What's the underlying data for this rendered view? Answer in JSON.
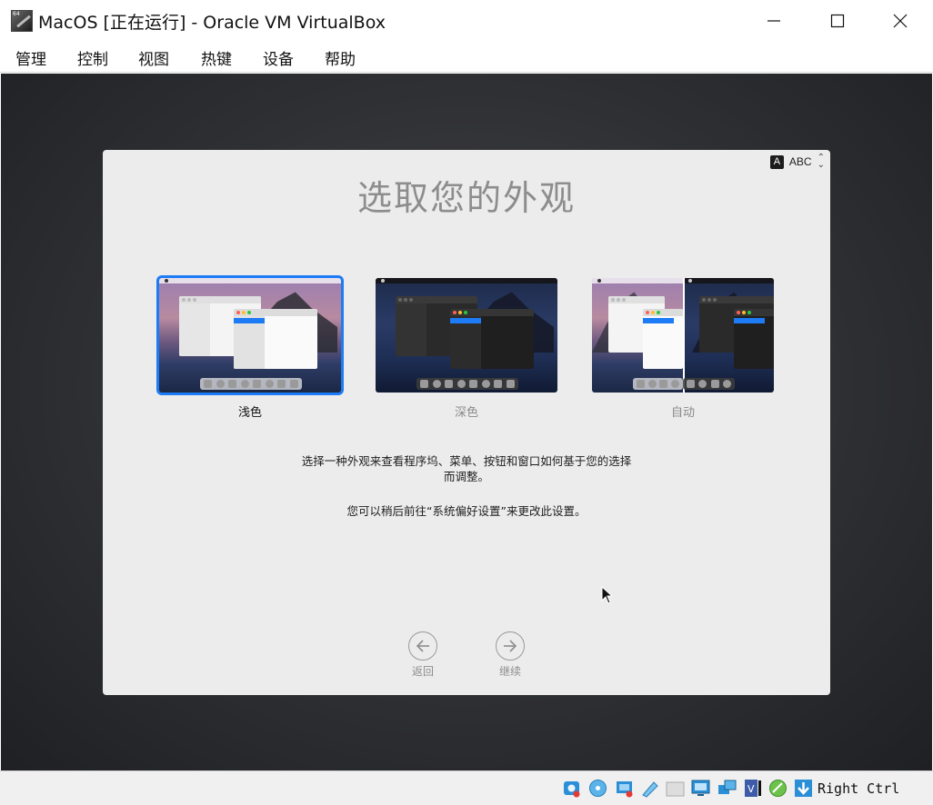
{
  "window": {
    "title": "MacOS [正在运行] - Oracle VM VirtualBox",
    "app_icon_badge": "64"
  },
  "menubar": {
    "items": [
      {
        "label": "管理"
      },
      {
        "label": "控制"
      },
      {
        "label": "视图"
      },
      {
        "label": "热键"
      },
      {
        "label": "设备"
      },
      {
        "label": "帮助"
      }
    ]
  },
  "guest": {
    "input_menu": {
      "badge": "A",
      "label": "ABC"
    },
    "title": "选取您的外观",
    "options": [
      {
        "label": "浅色",
        "selected": true
      },
      {
        "label": "深色",
        "selected": false
      },
      {
        "label": "自动",
        "selected": false
      }
    ],
    "description_line1": "选择一种外观来查看程序坞、菜单、按钮和窗口如何基于您的选择",
    "description_line2": "而调整。",
    "description_note": "您可以稍后前往“系统偏好设置”来更改此设置。",
    "back_label": "返回",
    "continue_label": "继续"
  },
  "statusbar": {
    "icons": [
      "hard-disk-icon",
      "optical-disk-icon",
      "audio-icon",
      "network-icon",
      "usb-icon",
      "shared-folders-icon",
      "display-icon",
      "recording-icon",
      "cpu-icon",
      "mouse-integration-icon",
      "keyboard-icon"
    ],
    "host_key": "Right Ctrl"
  },
  "colors": {
    "accent_blue": "#1d7bf5",
    "sheet_bg": "#ececec",
    "title_gray": "#8d8d8d"
  }
}
